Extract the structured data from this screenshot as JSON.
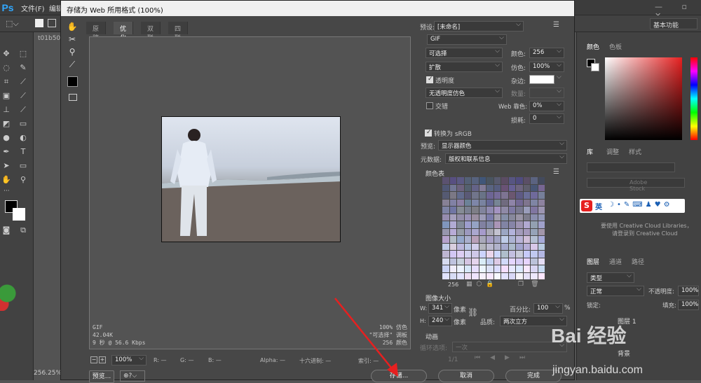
{
  "ps": {
    "logo": "Ps",
    "menu": [
      "文件(F)",
      "编辑"
    ],
    "workspace": "基本功能",
    "doc_tab": "t01b50",
    "zoom": "256.25%"
  },
  "right_panels": {
    "color_tabs": [
      "颜色",
      "色板"
    ],
    "lib_tabs": [
      "库",
      "调整",
      "样式"
    ],
    "lib_hint": "Adobe Stock",
    "lib_text1": "要使用 Creative Cloud Libraries，",
    "lib_text2": "请登录到 Creative Cloud",
    "ime_label": "英",
    "layer_tabs": [
      "图层",
      "通道",
      "路径"
    ],
    "layer_kind": "类型",
    "blend_mode": "正常",
    "opacity_label": "不透明度:",
    "opacity_value": "100%",
    "lock_label": "锁定:",
    "fill_label": "填充:",
    "fill_value": "100%",
    "layer_name_1": "图层 1",
    "layer_name_2": "背景"
  },
  "dialog": {
    "title": "存储为 Web 所用格式 (100%)",
    "view_tabs": [
      "原稿",
      "优化",
      "双联",
      "四联"
    ],
    "active_tab": "优化",
    "preview_info_left": [
      "GIF",
      "42.04K",
      "9 秒 @ 56.6 Kbps"
    ],
    "preview_info_right": [
      "100% 仿色",
      "\"可选择\" 调板",
      "256 颜色"
    ],
    "zoom_select": "100%",
    "status": {
      "r": "R: —",
      "g": "G: —",
      "b": "B: —",
      "alpha": "Alpha: —",
      "hex": "十六进制: —",
      "index": "索引: —"
    },
    "buttons": {
      "preview": "预览...",
      "save": "存储...",
      "cancel": "取消",
      "done": "完成"
    },
    "settings": {
      "preset_label": "预设:",
      "preset_value": "[未命名]",
      "format": "GIF",
      "reduction": "可选择",
      "dither_algo": "扩散",
      "transparency_label": "透明度",
      "transparency_dither": "无透明度仿色",
      "interlaced_label": "交错",
      "colors_label": "颜色:",
      "colors_value": "256",
      "dither_label": "仿色:",
      "dither_value": "100%",
      "matte_label": "杂边:",
      "amount_label": "数量:",
      "web_snap_label": "Web 靠色:",
      "web_snap_value": "0%",
      "lossy_label": "损耗:",
      "lossy_value": "0",
      "convert_srgb": "转换为 sRGB",
      "preview_label": "预览:",
      "preview_value": "显示器颜色",
      "metadata_label": "元数据:",
      "metadata_value": "版权和联系信息"
    },
    "color_table": {
      "title": "颜色表",
      "count": "256"
    },
    "image_size": {
      "title": "图像大小",
      "w_label": "W:",
      "w_value": "341",
      "h_label": "H:",
      "h_value": "240",
      "unit": "像素",
      "percent_label": "百分比:",
      "percent_value": "100",
      "percent_unit": "%",
      "quality_label": "品质:",
      "quality_value": "两次立方"
    },
    "animation": {
      "title": "动画",
      "loop_label": "循环选项:",
      "loop_value": "一次",
      "frame": "1/1"
    }
  },
  "watermark": {
    "text": "Bai 经验",
    "url": "jingyan.baidu.com"
  },
  "colors": {
    "accent_red": "#e62020",
    "ps_blue": "#31a8ff"
  }
}
